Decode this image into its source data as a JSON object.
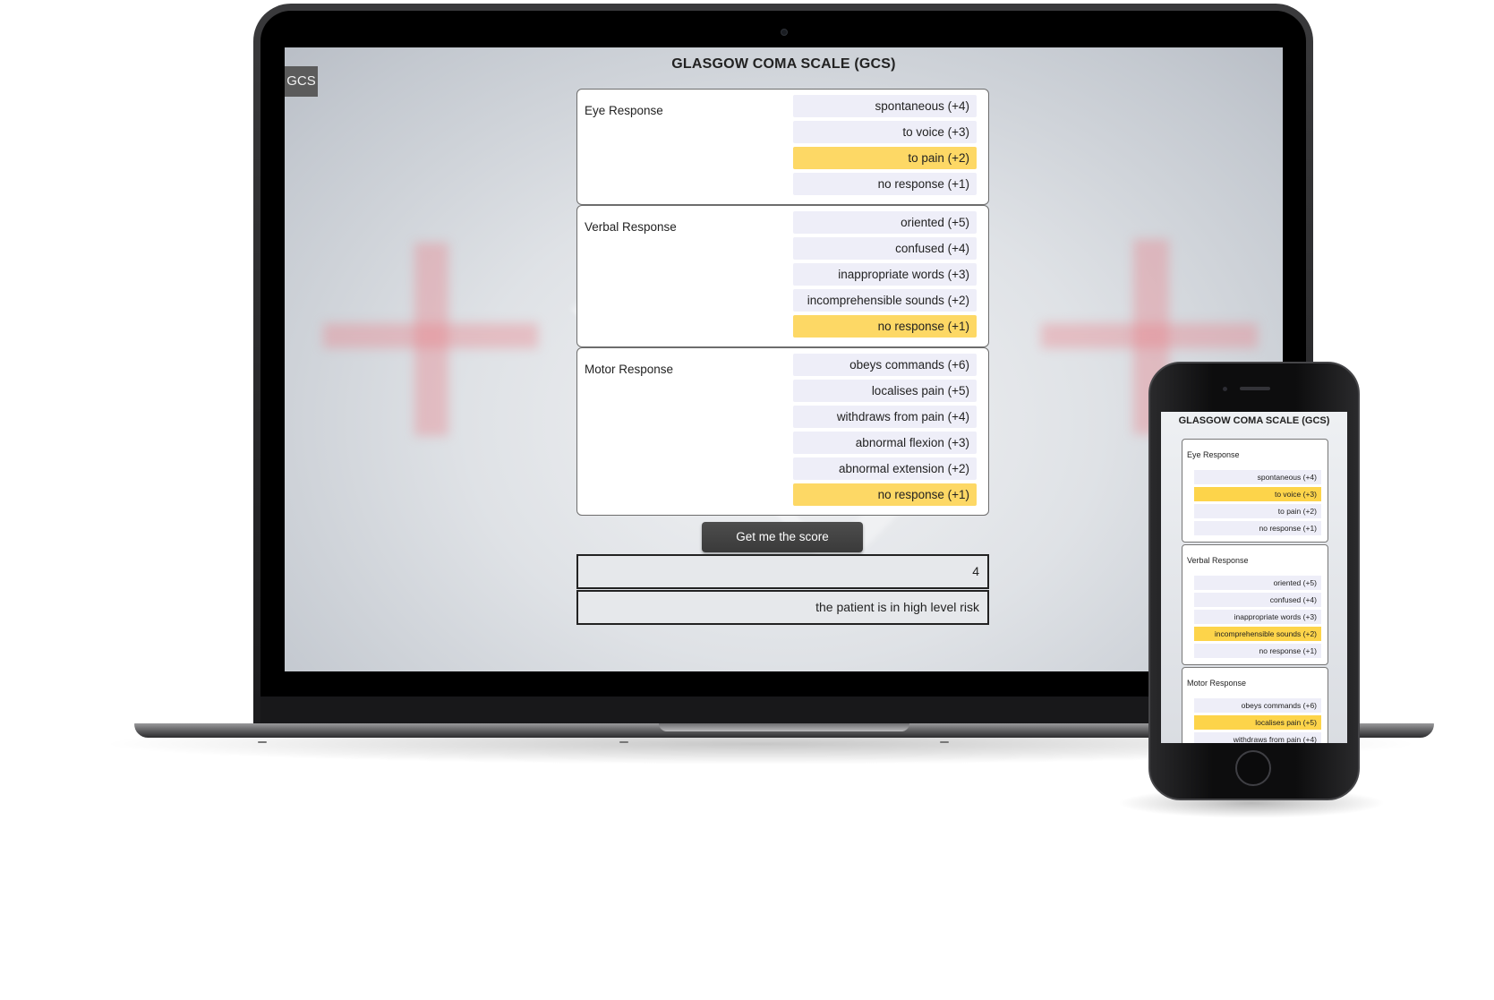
{
  "laptop": {
    "tab_label": "GCS",
    "title": "GLASGOW COMA SCALE (GCS)",
    "groups": [
      {
        "label": "Eye Response",
        "options": [
          {
            "label": "spontaneous (+4)",
            "selected": false
          },
          {
            "label": "to voice (+3)",
            "selected": false
          },
          {
            "label": "to pain (+2)",
            "selected": true
          },
          {
            "label": "no response (+1)",
            "selected": false
          }
        ]
      },
      {
        "label": "Verbal Response",
        "options": [
          {
            "label": "oriented (+5)",
            "selected": false
          },
          {
            "label": "confused (+4)",
            "selected": false
          },
          {
            "label": "inappropriate words (+3)",
            "selected": false
          },
          {
            "label": "incomprehensible sounds (+2)",
            "selected": false
          },
          {
            "label": "no response (+1)",
            "selected": true
          }
        ]
      },
      {
        "label": "Motor Response",
        "options": [
          {
            "label": "obeys commands (+6)",
            "selected": false
          },
          {
            "label": "localises pain (+5)",
            "selected": false
          },
          {
            "label": "withdraws from pain (+4)",
            "selected": false
          },
          {
            "label": "abnormal flexion (+3)",
            "selected": false
          },
          {
            "label": "abnormal extension (+2)",
            "selected": false
          },
          {
            "label": "no response (+1)",
            "selected": true
          }
        ]
      }
    ],
    "button_label": "Get me the score",
    "score": "4",
    "risk_text": "the patient is in high level risk"
  },
  "phone": {
    "title": "GLASGOW COMA SCALE (GCS)",
    "groups": [
      {
        "label": "Eye Response",
        "options": [
          {
            "label": "spontaneous (+4)",
            "selected": false
          },
          {
            "label": "to voice (+3)",
            "selected": true
          },
          {
            "label": "to pain (+2)",
            "selected": false
          },
          {
            "label": "no response (+1)",
            "selected": false
          }
        ]
      },
      {
        "label": "Verbal Response",
        "options": [
          {
            "label": "oriented (+5)",
            "selected": false
          },
          {
            "label": "confused (+4)",
            "selected": false
          },
          {
            "label": "inappropriate words (+3)",
            "selected": false
          },
          {
            "label": "incomprehensible sounds (+2)",
            "selected": true
          },
          {
            "label": "no response (+1)",
            "selected": false
          }
        ]
      },
      {
        "label": "Motor Response",
        "options": [
          {
            "label": "obeys commands (+6)",
            "selected": false
          },
          {
            "label": "localises pain (+5)",
            "selected": true
          },
          {
            "label": "withdraws from pain (+4)",
            "selected": false
          }
        ]
      }
    ]
  },
  "colors": {
    "selected_option": "#fdd865",
    "option_background": "#eeeef8",
    "button_background": "#444444"
  }
}
